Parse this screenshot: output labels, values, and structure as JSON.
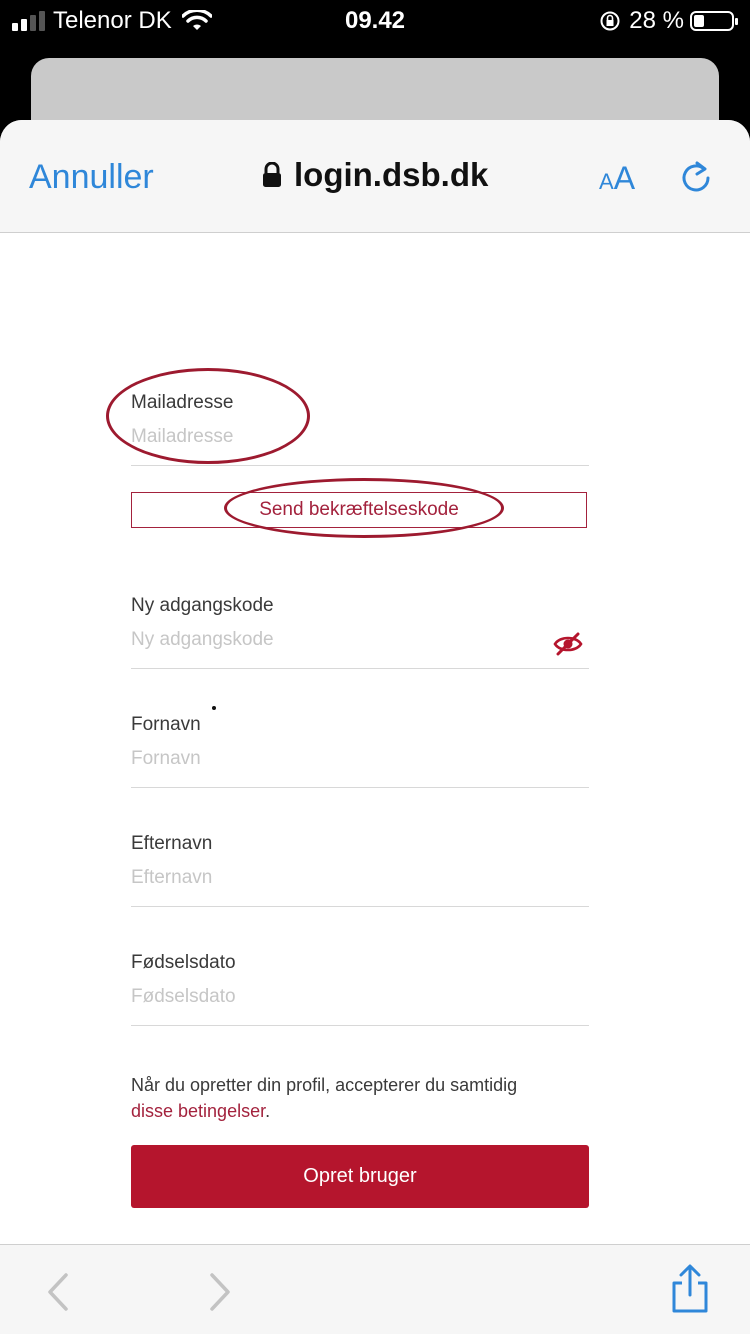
{
  "status_bar": {
    "carrier": "Telenor DK",
    "time": "09.42",
    "battery": "28 %"
  },
  "browser": {
    "cancel_label": "Annuller",
    "url": "login.dsb.dk",
    "text_size_label": "AA"
  },
  "form": {
    "email": {
      "label": "Mailadresse",
      "placeholder": "Mailadresse"
    },
    "send_code_label": "Send bekræftelseskode",
    "password": {
      "label": "Ny adgangskode",
      "placeholder": "Ny adgangskode"
    },
    "first_name": {
      "label": "Fornavn",
      "placeholder": "Fornavn"
    },
    "last_name": {
      "label": "Efternavn",
      "placeholder": "Efternavn"
    },
    "birthdate": {
      "label": "Fødselsdato",
      "placeholder": "Fødselsdato"
    },
    "terms_text": "Når du opretter din profil, accepterer du samtidig",
    "terms_link": "disse betingelser",
    "terms_end": ".",
    "submit_label": "Opret bruger"
  },
  "colors": {
    "accent_blue": "#2f87d9",
    "brand_red": "#b5152d",
    "annotation_red": "#9d1a2f"
  }
}
